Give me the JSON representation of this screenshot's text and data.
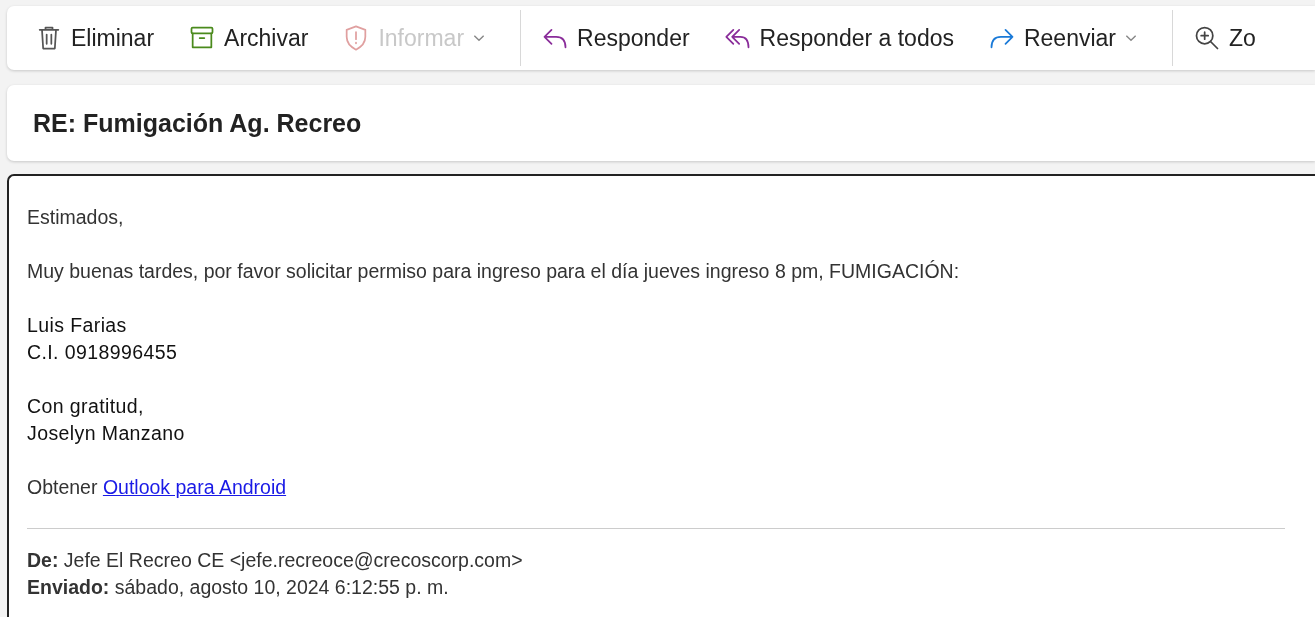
{
  "toolbar": {
    "groups": [
      [
        {
          "kind": "delete",
          "label": "Eliminar",
          "disabled": false,
          "dropdown": false
        },
        {
          "kind": "archive",
          "label": "Archivar",
          "disabled": false,
          "dropdown": false
        },
        {
          "kind": "report",
          "label": "Informar",
          "disabled": true,
          "dropdown": true
        }
      ],
      [
        {
          "kind": "reply",
          "label": "Responder",
          "disabled": false,
          "dropdown": false
        },
        {
          "kind": "reply_all",
          "label": "Responder a todos",
          "disabled": false,
          "dropdown": false
        },
        {
          "kind": "forward",
          "label": "Reenviar",
          "disabled": false,
          "dropdown": true
        }
      ],
      [
        {
          "kind": "zoom",
          "label": "Zo",
          "disabled": false,
          "dropdown": false
        }
      ]
    ]
  },
  "subject": "RE: Fumigación Ag. Recreo",
  "body": {
    "paragraphs": [
      {
        "kind": "text",
        "lines": [
          "Estimados,"
        ]
      },
      {
        "kind": "text",
        "lines": [
          "Muy buenas tardes, por favor solicitar permiso para ingreso para el día jueves ingreso 8 pm, FUMIGACIÓN:"
        ]
      },
      {
        "kind": "signature",
        "lines": [
          "Luis Farias",
          "C.I. 0918996455"
        ]
      },
      {
        "kind": "signature",
        "lines": [
          "Con gratitud,",
          "Joselyn Manzano"
        ]
      },
      {
        "kind": "link",
        "text": "Obtener",
        "link": "Outlook para Android"
      }
    ],
    "header_lines": [
      "**De:** Jefe El Recreo CE <jefe.recreoce@crecoscorp.com>",
      "**Enviado:** sábado, agosto 10, 2024 6:12:55 p. m."
    ]
  }
}
